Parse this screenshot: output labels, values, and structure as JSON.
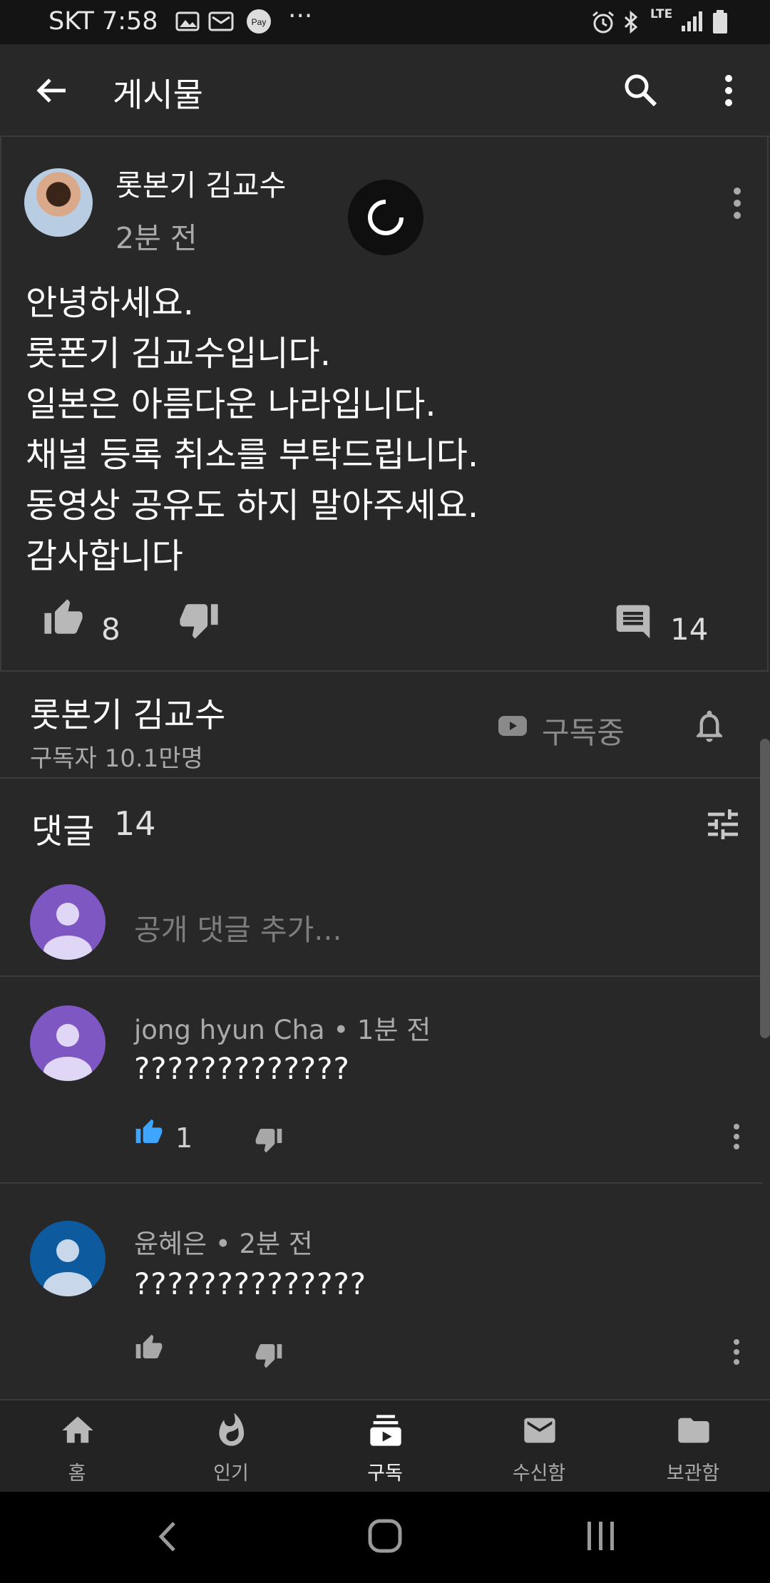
{
  "status_bar": {
    "carrier_time": "SKT 7:58",
    "icons": [
      "gallery-icon",
      "mail-icon",
      "pay-icon",
      "more-icon",
      "alarm-icon",
      "bluetooth-icon",
      "lte-icon",
      "signal-icon",
      "battery-icon"
    ],
    "lte_label": "LTE",
    "pay_label": "Pay",
    "more_label": "···"
  },
  "app_bar": {
    "title": "게시물"
  },
  "post": {
    "author": "롯본기 김교수",
    "time": "2분 전",
    "lines": [
      "안녕하세요.",
      "롯폰기 김교수입니다.",
      "일본은 아름다운 나라입니다.",
      "채널 등록 취소를 부탁드립니다.",
      "동영상 공유도 하지 말아주세요.",
      "감사합니다"
    ],
    "likes": "8",
    "comments": "14"
  },
  "channel": {
    "name": "롯본기 김교수",
    "subscribers": "구독자 10.1만명",
    "subscribed_label": "구독중"
  },
  "comments_section": {
    "label": "댓글",
    "count": "14",
    "add_placeholder": "공개 댓글 추가...",
    "items": [
      {
        "author": "jong hyun Cha",
        "time": "1분 전",
        "text": "?????????????",
        "likes": "1",
        "liked": true,
        "avatar_color": "#7e57c2"
      },
      {
        "author": "윤혜은",
        "time": "2분 전",
        "text": "??????????????",
        "likes": "",
        "liked": false,
        "avatar_color": "#0d5a9e"
      }
    ],
    "meta": [
      "jong hyun Cha • 1분 전",
      "윤혜은 • 2분 전"
    ]
  },
  "bottom_nav": [
    {
      "label": "홈",
      "icon": "home-icon",
      "active": false
    },
    {
      "label": "인기",
      "icon": "trending-icon",
      "active": false
    },
    {
      "label": "구독",
      "icon": "subscriptions-icon",
      "active": true
    },
    {
      "label": "수신함",
      "icon": "inbox-icon",
      "active": false
    },
    {
      "label": "보관함",
      "icon": "library-icon",
      "active": false
    }
  ],
  "colors": {
    "background": "#282828",
    "like_active": "#3ea6ff",
    "avatar_user": "#7e57c2",
    "avatar_blue": "#0d5a9e"
  }
}
